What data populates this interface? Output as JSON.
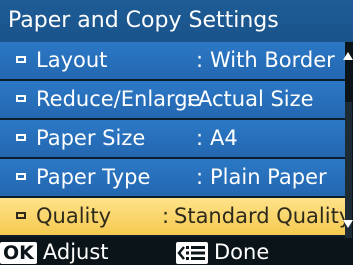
{
  "screen": {
    "title": "Paper and Copy Settings"
  },
  "menu": {
    "items": [
      {
        "label": "Layout",
        "colon": ":",
        "value": "With Border"
      },
      {
        "label": "Reduce/Enlarge",
        "colon": ":",
        "value": "Actual Size"
      },
      {
        "label": "Paper Size",
        "colon": ":",
        "value": "A4"
      },
      {
        "label": "Paper Type",
        "colon": ":",
        "value": "Plain Paper"
      },
      {
        "label": "Quality",
        "colon": ":",
        "value": "Standard Quality"
      }
    ],
    "selected_index": 4
  },
  "footer": {
    "ok_key": "OK",
    "ok_label": "Adjust",
    "done_icon": "back-menu-icon",
    "done_label": "Done"
  },
  "colors": {
    "title_bg": "#1a538a",
    "row_bg": "#2367b0",
    "selected_bg": "#f4c94f",
    "screen_bg": "#0b1418"
  }
}
